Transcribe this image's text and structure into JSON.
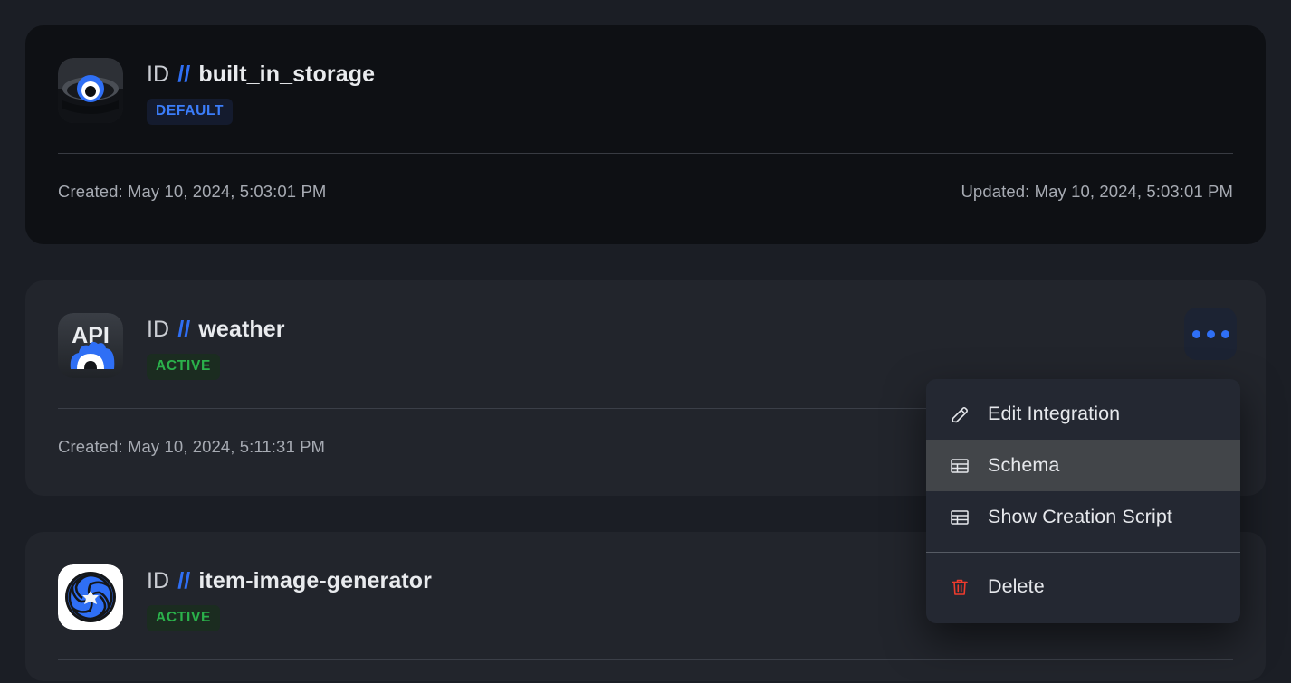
{
  "theme": {
    "page_bg": "#1b1e25",
    "card_dark_bg": "#0e1014",
    "card_bg": "#22252c",
    "accent_blue": "#2f6ff5",
    "badge_default_fg": "#3b7dfa",
    "badge_active_fg": "#2bb14b",
    "menu_bg": "#242832",
    "menu_hover_bg": "#424549",
    "danger_red": "#ef3b2d"
  },
  "labels": {
    "id_prefix": "ID",
    "separator": "//"
  },
  "cards": [
    {
      "icon_name": "built-in-storage-icon",
      "name": "built_in_storage",
      "badge": "DEFAULT",
      "badge_kind": "default",
      "created": "Created: May 10, 2024, 5:03:01 PM",
      "updated": "Updated: May 10, 2024, 5:03:01 PM",
      "has_kebab": false
    },
    {
      "icon_name": "api-weather-icon",
      "name": "weather",
      "badge": "ACTIVE",
      "badge_kind": "active",
      "created": "Created: May 10, 2024, 5:11:31 PM",
      "updated": "",
      "has_kebab": true
    },
    {
      "icon_name": "item-image-generator-icon",
      "name": "item-image-generator",
      "badge": "ACTIVE",
      "badge_kind": "active",
      "created": "",
      "updated": "",
      "has_kebab": true
    }
  ],
  "context_menu": {
    "open": true,
    "items": [
      {
        "label": "Edit Integration",
        "icon": "pencil-icon",
        "highlighted": false,
        "danger": false
      },
      {
        "label": "Schema",
        "icon": "table-icon",
        "highlighted": true,
        "danger": false
      },
      {
        "label": "Show Creation Script",
        "icon": "table-icon",
        "highlighted": false,
        "danger": false
      }
    ],
    "danger_item": {
      "label": "Delete",
      "icon": "trash-icon",
      "danger": true
    }
  }
}
